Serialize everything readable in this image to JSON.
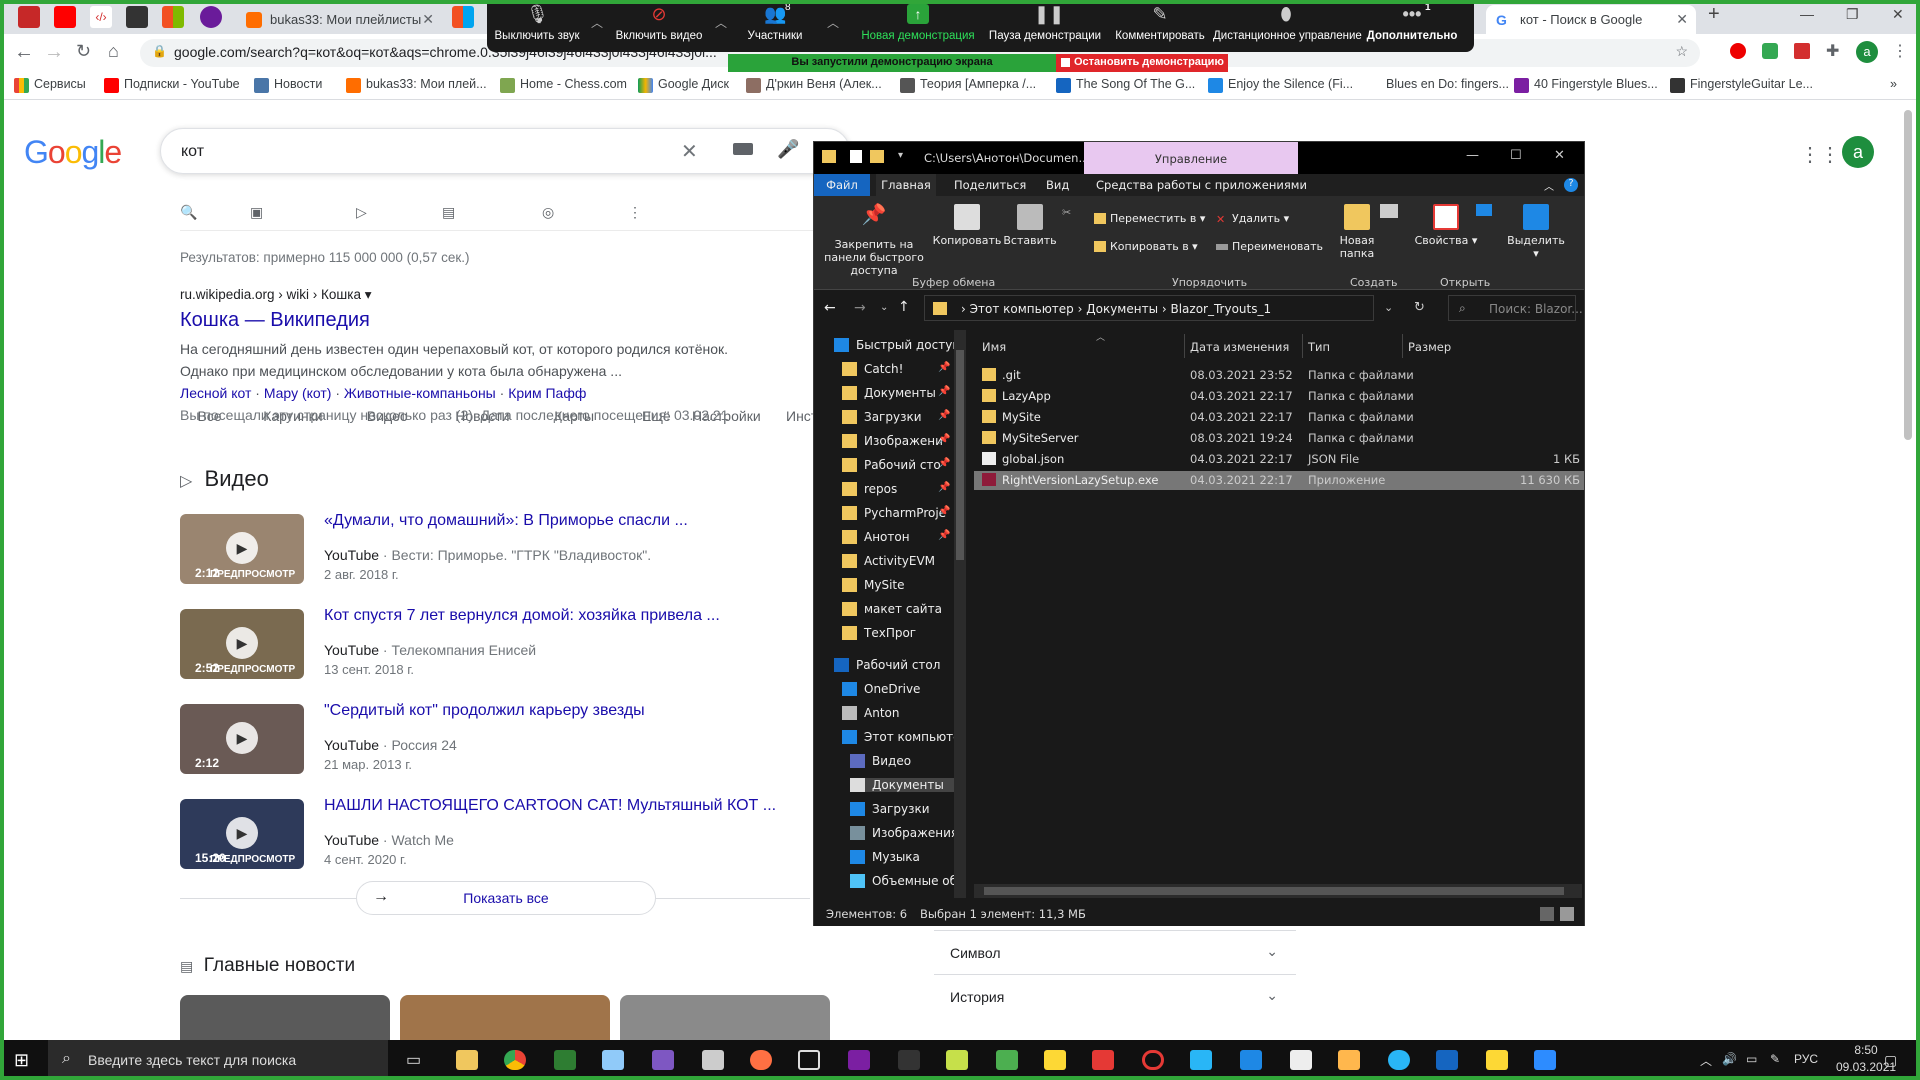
{
  "chrome": {
    "tabs": [
      {
        "label": "bukas33: Мои плейлисты",
        "color": "#ff6d00"
      },
      {
        "label": "кот - Поиск в Google",
        "color": "#4285f4"
      }
    ],
    "url": "google.com/search?q=кот&oq=кот&aqs=chrome.0.35i39j46i39j46i433j0i433j46i433j0i...",
    "bookmarks": [
      "Сервисы",
      "Подписки - YouTube",
      "Новости",
      "bukas33: Мои плей...",
      "Home - Chess.com",
      "Google Диск",
      "Д'ркин Веня (Алек...",
      "Теория [Амперка /...",
      "The Song Of The G...",
      "Enjoy the Silence (Fi...",
      "Blues en Do: fingers...",
      "40 Fingerstyle Blues...",
      "FingerstyleGuitar Le..."
    ],
    "avatar": "a"
  },
  "zoom": {
    "buttons": [
      "Выключить звук",
      "Включить видео",
      "Участники",
      "Новая демонстрация",
      "Пауза демонстрации",
      "Комментировать",
      "Дистанционное управление",
      "Дополнительно"
    ],
    "participants_count": "8",
    "more_count": "1",
    "share_status": "Вы запустили демонстрацию экрана",
    "stop_label": "Остановить демонстрацию"
  },
  "google": {
    "query": "кот",
    "tabs": [
      "Все",
      "Картинки",
      "Видео",
      "Новости",
      "Карты",
      "Ещё",
      "Настройки",
      "Инструменты"
    ],
    "stats": "Результатов: примерно 115 000 000 (0,57 сек.)",
    "result": {
      "cite": "ru.wikipedia.org › wiki › Кошка",
      "title": "Кошка — Википедия",
      "snippet1": "На сегодняшний день известен один черепаховый кот, от которого родился котёнок.",
      "snippet2": "Однако при медицинском обследовании у кота была обнаружена ...",
      "links": [
        "Лесной кот",
        "Мару (кот)",
        "Животные-компаньоны",
        "Крим Пафф"
      ],
      "visited": "Вы посещали эту страницу несколько раз (2). Дата последнего посещения: 03.02.21"
    },
    "videos_heading": "Видео",
    "videos": [
      {
        "title": "«Думали, что домашний»: В Приморье спасли ...",
        "source": "YouTube",
        "channel": "Вести: Приморье. \"ГТРК \"Владивосток\".",
        "date": "2 авг. 2018 г.",
        "duration": "2:12",
        "preview": "ПРЕДПРОСМОТР"
      },
      {
        "title": "Кот спустя 7 лет вернулся домой: хозяйка привела ...",
        "source": "YouTube",
        "channel": "Телекомпания Енисей",
        "date": "13 сент. 2018 г.",
        "duration": "2:52",
        "preview": "ПРЕДПРОСМОТР"
      },
      {
        "title": "\"Сердитый кот\" продолжил карьеру звезды",
        "source": "YouTube",
        "channel": "Россия 24",
        "date": "21 мар. 2013 г.",
        "duration": "2:12",
        "preview": ""
      },
      {
        "title": "НАШЛИ НАСТОЯЩЕГО CARTOON CAT! Мультяшный КОТ ...",
        "source": "YouTube",
        "channel": "Watch Me",
        "date": "4 сент. 2020 г.",
        "duration": "15:20",
        "preview": "ПРЕДПРОСМОТР"
      }
    ],
    "show_all": "Показать все",
    "news_heading": "Главные новости",
    "panels": [
      "Символ",
      "История"
    ]
  },
  "explorer": {
    "title_path": "C:\\Users\\Анотон\\Documen...",
    "manage_tab": "Управление",
    "ribbon_tabs": [
      "Файл",
      "Главная",
      "Поделиться",
      "Вид",
      "Средства работы с приложениями"
    ],
    "pin_label": "Закрепить на панели быстрого доступа",
    "copy": "Копировать",
    "paste": "Вставить",
    "move_to": "Переместить в",
    "copy_to": "Копировать в",
    "delete": "Удалить",
    "rename": "Переименовать",
    "new_folder": "Новая папка",
    "properties": "Свойства",
    "select": "Выделить",
    "sections": [
      "Буфер обмена",
      "Упорядочить",
      "Создать",
      "Открыть"
    ],
    "breadcrumb": [
      "Этот компьютер",
      "Документы",
      "Blazor_Tryouts_1"
    ],
    "search_placeholder": "Поиск: Blazor...",
    "nav": [
      {
        "label": "Быстрый доступ",
        "pinned": false
      },
      {
        "label": "Catch!",
        "pinned": true
      },
      {
        "label": "Документы",
        "pinned": true
      },
      {
        "label": "Загрузки",
        "pinned": true
      },
      {
        "label": "Изображени",
        "pinned": true
      },
      {
        "label": "Рабочий сто",
        "pinned": true
      },
      {
        "label": "repos",
        "pinned": true
      },
      {
        "label": "PycharmProje",
        "pinned": true
      },
      {
        "label": "Анотон",
        "pinned": true
      },
      {
        "label": "ActivityEVM",
        "pinned": false
      },
      {
        "label": "MySite",
        "pinned": false
      },
      {
        "label": "макет сайта",
        "pinned": false
      },
      {
        "label": "ТехПрог",
        "pinned": false
      },
      {
        "label": "Рабочий стол",
        "pinned": false
      },
      {
        "label": "OneDrive",
        "pinned": false
      },
      {
        "label": "Anton",
        "pinned": false
      },
      {
        "label": "Этот компьютер",
        "pinned": false
      },
      {
        "label": "Видео",
        "pinned": false
      },
      {
        "label": "Документы",
        "pinned": false
      },
      {
        "label": "Загрузки",
        "pinned": false
      },
      {
        "label": "Изображения",
        "pinned": false
      },
      {
        "label": "Музыка",
        "pinned": false
      },
      {
        "label": "Объемные об",
        "pinned": false
      }
    ],
    "columns": [
      "Имя",
      "Дата изменения",
      "Тип",
      "Размер"
    ],
    "files": [
      {
        "name": ".git",
        "date": "08.03.2021 23:52",
        "type": "Папка с файлами",
        "size": "",
        "kind": "folder"
      },
      {
        "name": "LazyApp",
        "date": "04.03.2021 22:17",
        "type": "Папка с файлами",
        "size": "",
        "kind": "folder"
      },
      {
        "name": "MySite",
        "date": "04.03.2021 22:17",
        "type": "Папка с файлами",
        "size": "",
        "kind": "folder"
      },
      {
        "name": "MySiteServer",
        "date": "08.03.2021 19:24",
        "type": "Папка с файлами",
        "size": "",
        "kind": "folder"
      },
      {
        "name": "global.json",
        "date": "04.03.2021 22:17",
        "type": "JSON File",
        "size": "1 КБ",
        "kind": "json"
      },
      {
        "name": "RightVersionLazySetup.exe",
        "date": "04.03.2021 22:17",
        "type": "Приложение",
        "size": "11 630 КБ",
        "kind": "exe"
      }
    ],
    "status_count": "Элементов: 6",
    "status_selected": "Выбран 1 элемент: 11,3 МБ"
  },
  "taskbar": {
    "search_placeholder": "Введите здесь текст для поиска",
    "lang": "РУС",
    "time": "8:50",
    "date": "09.03.2021"
  }
}
